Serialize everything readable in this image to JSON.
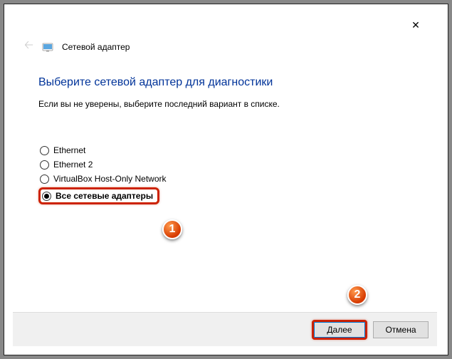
{
  "window": {
    "title": "Сетевой адаптер"
  },
  "content": {
    "heading": "Выберите сетевой адаптер для диагностики",
    "subtext": "Если вы не уверены, выберите последний вариант в списке."
  },
  "adapters": {
    "items": [
      {
        "label": "Ethernet",
        "checked": false
      },
      {
        "label": "Ethernet 2",
        "checked": false
      },
      {
        "label": "VirtualBox Host-Only Network",
        "checked": false
      },
      {
        "label": "Все сетевые адаптеры",
        "checked": true
      }
    ]
  },
  "buttons": {
    "next": "Далее",
    "cancel": "Отмена"
  },
  "callouts": {
    "one": "1",
    "two": "2"
  }
}
